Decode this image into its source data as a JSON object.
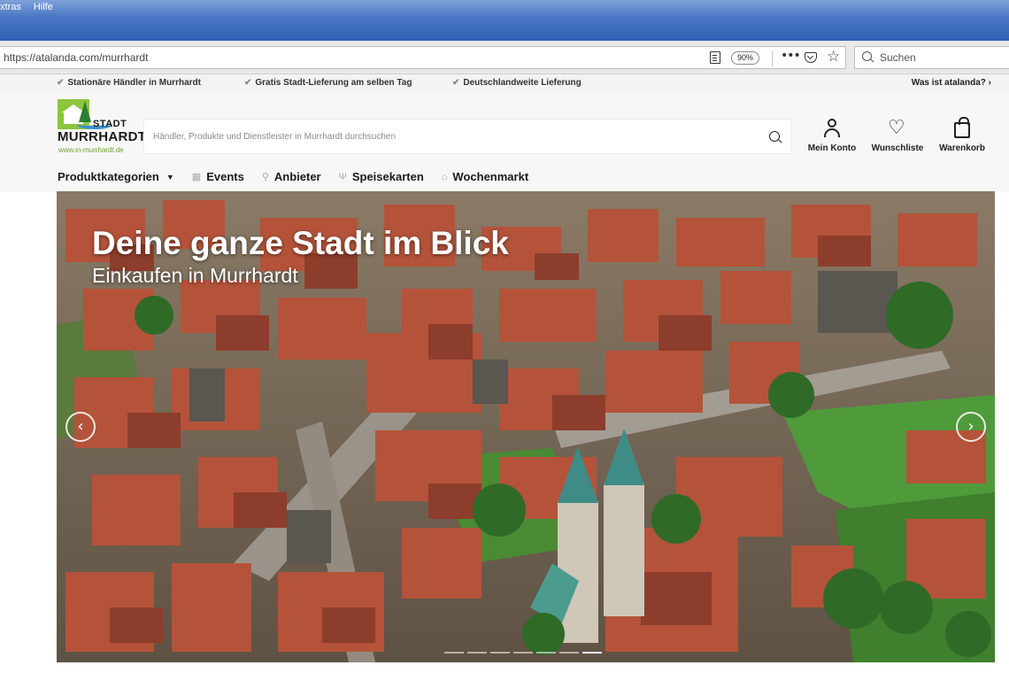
{
  "window": {
    "menu": [
      "xtras",
      "Hilfe"
    ]
  },
  "browser": {
    "url": "https://atalanda.com/murrhardt",
    "zoom": "90%",
    "search_placeholder": "Suchen",
    "icons": [
      "reader-view-icon",
      "more-icon",
      "pocket-icon",
      "bookmark-star-icon",
      "search-icon"
    ]
  },
  "usp": {
    "items": [
      "Stationäre Händler in Murrhardt",
      "Gratis Stadt-Lieferung am selben Tag",
      "Deutschlandweite Lieferung"
    ],
    "right_link": "Was ist atalanda?"
  },
  "header": {
    "logo": {
      "stadt": "STADT",
      "name": "MURRHARDT",
      "url": "www.in-murrhardt.de"
    },
    "search_placeholder": "Händler, Produkte und Dienstleister in Murrhardt durchsuchen",
    "actions": {
      "account": "Mein Konto",
      "wishlist": "Wunschliste",
      "cart": "Warenkorb"
    },
    "nav": {
      "categories": "Produktkategorien",
      "events": "Events",
      "vendors": "Anbieter",
      "menus": "Speisekarten",
      "market": "Wochenmarkt"
    }
  },
  "hero": {
    "title": "Deine ganze Stadt im Blick",
    "subtitle": "Einkaufen in Murrhardt",
    "slide_count": 7,
    "active_slide": 7,
    "prev_glyph": "‹",
    "next_glyph": "›"
  },
  "colors": {
    "brand_green": "#8cc63f",
    "title_bar_blue": "#3e6bbf"
  }
}
